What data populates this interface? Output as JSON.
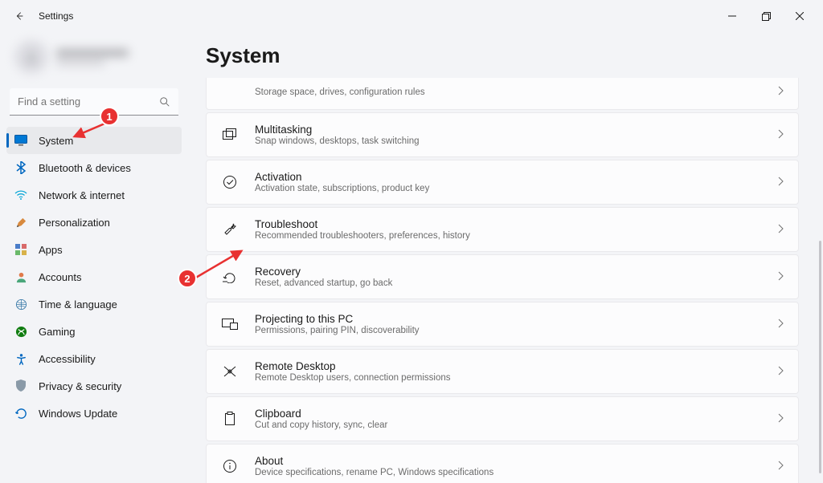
{
  "titlebar": {
    "app_title": "Settings"
  },
  "search": {
    "placeholder": "Find a setting"
  },
  "sidebar": {
    "items": [
      {
        "label": "System",
        "active": true
      },
      {
        "label": "Bluetooth & devices"
      },
      {
        "label": "Network & internet"
      },
      {
        "label": "Personalization"
      },
      {
        "label": "Apps"
      },
      {
        "label": "Accounts"
      },
      {
        "label": "Time & language"
      },
      {
        "label": "Gaming"
      },
      {
        "label": "Accessibility"
      },
      {
        "label": "Privacy & security"
      },
      {
        "label": "Windows Update"
      }
    ]
  },
  "main": {
    "heading": "System",
    "cards": [
      {
        "title": "",
        "sub": "Storage space, drives, configuration rules",
        "truncated": true
      },
      {
        "title": "Multitasking",
        "sub": "Snap windows, desktops, task switching"
      },
      {
        "title": "Activation",
        "sub": "Activation state, subscriptions, product key"
      },
      {
        "title": "Troubleshoot",
        "sub": "Recommended troubleshooters, preferences, history"
      },
      {
        "title": "Recovery",
        "sub": "Reset, advanced startup, go back"
      },
      {
        "title": "Projecting to this PC",
        "sub": "Permissions, pairing PIN, discoverability"
      },
      {
        "title": "Remote Desktop",
        "sub": "Remote Desktop users, connection permissions"
      },
      {
        "title": "Clipboard",
        "sub": "Cut and copy history, sync, clear"
      },
      {
        "title": "About",
        "sub": "Device specifications, rename PC, Windows specifications"
      }
    ]
  },
  "callouts": {
    "one": "1",
    "two": "2"
  }
}
